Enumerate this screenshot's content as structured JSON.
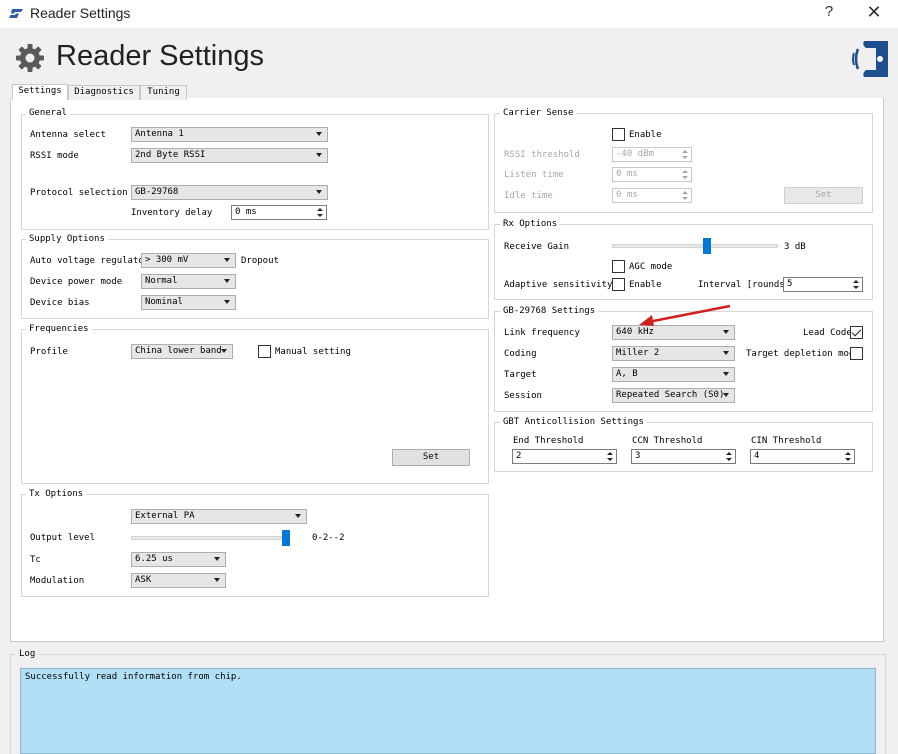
{
  "window": {
    "title": "Reader Settings",
    "help": "?",
    "close": "✕"
  },
  "header": {
    "title": "Reader Settings"
  },
  "tabs": [
    "Settings",
    "Diagnostics",
    "Tuning"
  ],
  "general": {
    "title": "General",
    "antenna_label": "Antenna select",
    "antenna_value": "Antenna 1",
    "rssi_label": "RSSI mode",
    "rssi_value": "2nd Byte RSSI",
    "protocol_label": "Protocol selection",
    "protocol_value": "GB-29768",
    "inv_delay_label": "Inventory delay",
    "inv_delay_value": "0 ms"
  },
  "supply": {
    "title": "Supply Options",
    "avr_label": "Auto voltage regulator",
    "avr_value": "> 300 mV",
    "dropout": "Dropout",
    "power_label": "Device power mode",
    "power_value": "Normal",
    "bias_label": "Device bias",
    "bias_value": "Nominal"
  },
  "frequencies": {
    "title": "Frequencies",
    "profile_label": "Profile",
    "profile_value": "China lower band",
    "manual_label": "Manual setting",
    "set": "Set"
  },
  "tx": {
    "title": "Tx Options",
    "pa_value": "External PA",
    "output_label": "Output level",
    "output_value": "0-2--2",
    "output_level": 0.98,
    "tc_label": "Tc",
    "tc_value": "6.25 us",
    "mod_label": "Modulation",
    "mod_value": "ASK"
  },
  "carrier": {
    "title": "Carrier Sense",
    "enable": "Enable",
    "rssi_th_label": "RSSI threshold",
    "rssi_th_value": "-40 dBm",
    "listen_label": "Listen time",
    "listen_value": "0 ms",
    "idle_label": "Idle time",
    "idle_value": "0 ms",
    "set": "Set"
  },
  "rx": {
    "title": "Rx Options",
    "gain_label": "Receive Gain",
    "gain_value": "3 dB",
    "gain_level": 0.57,
    "agc_label": "AGC mode",
    "adaptive_label": "Adaptive sensitivity",
    "adaptive_enable": "Enable",
    "interval_label": "Interval [rounds]",
    "interval_value": "5"
  },
  "gb": {
    "title": "GB-29768 Settings",
    "link_label": "Link frequency",
    "link_value": "640 kHz",
    "lead_label": "Lead Code",
    "coding_label": "Coding",
    "coding_value": "Miller 2",
    "depletion_label": "Target depletion mode",
    "target_label": "Target",
    "target_value": "A, B",
    "session_label": "Session",
    "session_value": "Repeated Search (S0)"
  },
  "gbt": {
    "title": "GBT Anticollision Settings",
    "end_label": "End Threshold",
    "end_value": "2",
    "ccn_label": "CCN Threshold",
    "ccn_value": "3",
    "cin_label": "CIN Threshold",
    "cin_value": "4"
  },
  "log": {
    "title": "Log",
    "text": "Successfully read information from chip."
  },
  "colors": {
    "accent": "#0078d7",
    "log_bg": "#b1dff5",
    "arrow": "#d02020"
  }
}
